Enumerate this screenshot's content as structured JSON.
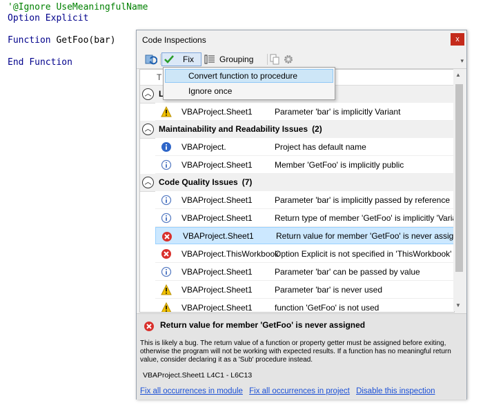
{
  "code": {
    "line1": "'@Ignore UseMeaningfulName",
    "line2_kw1": "Option",
    "line2_kw2": "Explicit",
    "line3_kw": "Function",
    "line3_rest": "GetFoo(bar)",
    "line4_kw1": "End",
    "line4_kw2": "Function"
  },
  "panel": {
    "title": "Code Inspections",
    "close": "x",
    "toolbar": {
      "fix_label": "Fix",
      "grouping_label": "Grouping",
      "overflow": "▾"
    },
    "header_partial": "T",
    "groups": [
      {
        "label": "L",
        "count": ""
      },
      {
        "label": "Maintainability and Readability Issues",
        "count": "(2)"
      },
      {
        "label": "Code Quality Issues",
        "count": "(7)"
      }
    ],
    "rows": [
      {
        "component": "VBAProject.Sheet1",
        "description": "Parameter 'bar' is implicitly Variant",
        "icon": "warning-icon"
      },
      {
        "component": "VBAProject.",
        "description": "Project has default name",
        "icon": "info-icon"
      },
      {
        "component": "VBAProject.Sheet1",
        "description": "Member 'GetFoo' is implicitly public",
        "icon": "hint-icon"
      },
      {
        "component": "VBAProject.Sheet1",
        "description": "Parameter 'bar' is implicitly passed by reference",
        "icon": "hint-icon"
      },
      {
        "component": "VBAProject.Sheet1",
        "description": "Return type of member 'GetFoo' is implicitly 'Variant'",
        "icon": "hint-icon"
      },
      {
        "component": "VBAProject.Sheet1",
        "description": "Return value for member 'GetFoo' is never assigned",
        "icon": "error-icon"
      },
      {
        "component": "VBAProject.ThisWorkbook",
        "description": "Option Explicit is not specified in 'ThisWorkbook'",
        "icon": "error-icon"
      },
      {
        "component": "VBAProject.Sheet1",
        "description": "Parameter 'bar' can be passed by value",
        "icon": "hint-icon"
      },
      {
        "component": "VBAProject.Sheet1",
        "description": "Parameter 'bar' is never used",
        "icon": "warning-icon"
      },
      {
        "component": "VBAProject.Sheet1",
        "description": "function 'GetFoo' is not used",
        "icon": "warning-icon"
      }
    ],
    "details": {
      "title": "Return value for member 'GetFoo' is never assigned",
      "description": "This is likely a bug. The return value of a function or property getter must be assigned before exiting, otherwise the program will not be working with expected results. If a function has no meaningful return value, consider declaring it as a 'Sub' procedure instead.",
      "selection": "VBAProject.Sheet1 L4C1 - L6C13",
      "links": {
        "fix_module": "Fix all occurrences in module",
        "fix_project": "Fix all occurrences in project",
        "disable": "Disable this inspection"
      }
    }
  },
  "dropdown": {
    "items": [
      "Convert function to procedure",
      "Ignore once"
    ]
  },
  "colors": {
    "selection": "#cce8ff",
    "error": "#d9302c",
    "warning": "#f2c200",
    "info": "#2f66c8",
    "link": "#1a4fd6",
    "close": "#c42b1c"
  }
}
